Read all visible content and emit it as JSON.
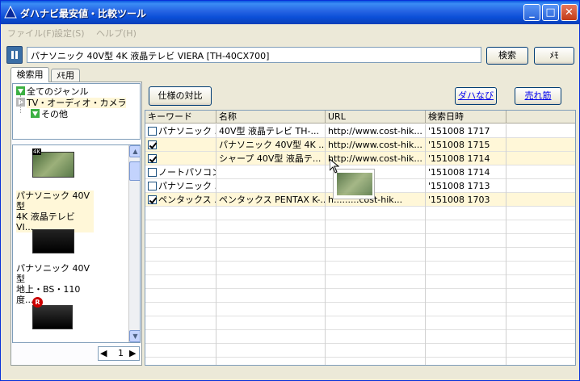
{
  "window": {
    "title": "ダハナビ最安値・比較ツール",
    "min": "_",
    "max": "□",
    "close": "✕"
  },
  "menu": [
    "ファイル(F)",
    "設定(S)",
    "ヘルプ(H)"
  ],
  "search": {
    "pause_icon": "pause-icon",
    "value": "パナソニック 40V型 4K 液晶テレビ VIERA [TH-40CX700]",
    "search_label": "検索",
    "memo_label": "ﾒﾓ"
  },
  "tabs": [
    "検索用",
    "ﾒﾓ用"
  ],
  "tree": {
    "items": [
      {
        "label": "全てのジャンル",
        "icon": "green-down-triangle-icon"
      },
      {
        "label": "TV・オーディオ・カメラ",
        "icon": "gray-right-triangle-icon"
      },
      {
        "label": "その他",
        "icon": "green-down-triangle-icon"
      }
    ]
  },
  "products": [
    {
      "line1": "パナソニック 40V型",
      "line2": "4K 液晶テレビ VI...",
      "badge": "4K"
    },
    {
      "line1": "パナソニック 40V型",
      "line2": "地上・BS・110度...",
      "badge": ""
    },
    {
      "line1": "",
      "line2": "",
      "badge": "R"
    }
  ],
  "pager": {
    "page": "1"
  },
  "toolbar": {
    "compare_label": "仕様の対比",
    "dahanavi_label": "ダハなび",
    "bestseller_label": "売れ筋"
  },
  "grid": {
    "columns": [
      "キーワード",
      "名称",
      "URL",
      "検索日時"
    ],
    "rows": [
      {
        "checked": false,
        "keyword": "パナソニック ...",
        "name": "40V型 液晶テレビ TH-...",
        "url": "http://www.cost-hik...",
        "time": "'151008 1717",
        "hl": false
      },
      {
        "checked": true,
        "keyword": "",
        "name": "パナソニック 40V型 4K ...",
        "url": "http://www.cost-hik...",
        "time": "'151008 1715",
        "hl": true
      },
      {
        "checked": true,
        "keyword": "",
        "name": "シャープ 40V型 液晶テ...",
        "url": "http://www.cost-hik...",
        "time": "'151008 1714",
        "hl": true
      },
      {
        "checked": false,
        "keyword": "ノートパソコン",
        "name": "",
        "url": "",
        "time": "'151008 1714",
        "hl": false
      },
      {
        "checked": false,
        "keyword": "パナソニック ...",
        "name": "",
        "url": "",
        "time": "'151008 1713",
        "hl": false
      },
      {
        "checked": true,
        "keyword": "ペンタックス ...",
        "name": "ペンタックス PENTAX K-...",
        "url": "h.........cost-hik...",
        "time": "'151008 1703",
        "hl": true
      }
    ]
  },
  "colors": {
    "accent": "#0a58e0",
    "highlight_row": "#fff7d8",
    "link": "#0000ee"
  }
}
